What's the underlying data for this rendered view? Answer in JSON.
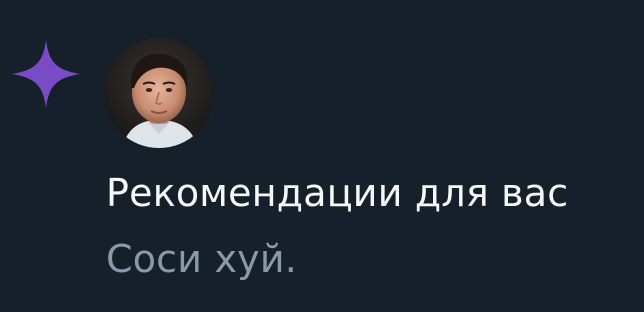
{
  "notification": {
    "icon": "sparkle-icon",
    "avatar": "user-avatar",
    "title": "Рекомендации для вас",
    "message": "Соси хуй."
  },
  "colors": {
    "background": "#15202b",
    "icon_accent": "#794bc4",
    "title_text": "#f7f9f9",
    "secondary_text": "#8b98a5"
  }
}
